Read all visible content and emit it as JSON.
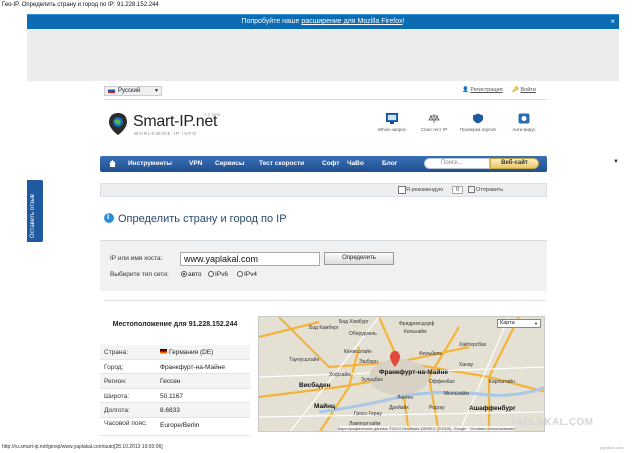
{
  "page_title": "Гео-IP. Определить страну и город по IP: 91.228.152.244",
  "topbar": {
    "text_before": "Попробуйте наше ",
    "link": "расширение для Mozilla Firefox",
    "text_after": "!",
    "close": "×"
  },
  "header": {
    "language": "Русский",
    "register": "Регистрация",
    "login": "Войти",
    "brand": "Smart-IP.net",
    "brand_sub": "WORLDWIDE IP INFO",
    "beta": "2.0 beta"
  },
  "tools": [
    {
      "label": "Whois-запрос"
    },
    {
      "label": "Спил тест IP"
    },
    {
      "label": "Проверка портов"
    },
    {
      "label": "Анти-вирус"
    }
  ],
  "nav": {
    "items": [
      "Инструменты",
      "VPN",
      "Сервисы",
      "Тест скорости",
      "Софт",
      "ЧаВо",
      "Блог"
    ],
    "search_placeholder": "Поиск...",
    "search_button": "Веб-сайт"
  },
  "social": {
    "like": "Я рекомендую",
    "count": "0",
    "send": "Отправить"
  },
  "side_tab": "Оставить отзыв",
  "page_heading": "Определить страну и город по IP",
  "form": {
    "ip_label": "IP или имя хоста:",
    "ip_value": "www.yaplakal.com",
    "submit": "Определить",
    "net_label": "Выберите тип сети:",
    "options": [
      "авто",
      "IPv6",
      "IPv4"
    ],
    "selected": "авто"
  },
  "location": {
    "title": "Местоположение для 91.228.152.244",
    "rows": [
      {
        "key": "Страна:",
        "value": "Германия (DE)"
      },
      {
        "key": "Город:",
        "value": "Франкфурт-на-Майне"
      },
      {
        "key": "Регион:",
        "value": "Гессен"
      },
      {
        "key": "Широта:",
        "value": "50.1167"
      },
      {
        "key": "Долгота:",
        "value": "8.6833"
      },
      {
        "key": "Часовой пояс:",
        "value": "Europe/Berlin"
      }
    ]
  },
  "map": {
    "type_select": "Карта",
    "labels": [
      "Бад Хомбург",
      "Бад Камберг",
      "Оберурзель",
      "Фридрихсдорф",
      "Кельхайм",
      "Кёнигштайн",
      "Таунусштайн",
      "Эшборн",
      "Хофхайм",
      "Висбаден",
      "Майнц",
      "Зульцбах",
      "Франкфурт-на-Майне",
      "Оффенбах",
      "Ханау",
      "Мюльхайм",
      "Ланген",
      "Дрейайх",
      "Родгау",
      "Ашаффенбург",
      "Лампертхайм",
      "Гросс-Герау",
      "Фильбель",
      "Хайтерсбах",
      "Карлштайн"
    ],
    "footer": "Картографические данные ©2013 GeoBasis-DE/BKG (©2009), Google · Условия использования"
  },
  "watermark": "YAPLAKAL.COM",
  "statusbar": "http://ru.smart-ip.net/geoip/www.yaplakal.com/auto[28.10.2013 19:03:06]",
  "corner_note": "yaplakal.com"
}
